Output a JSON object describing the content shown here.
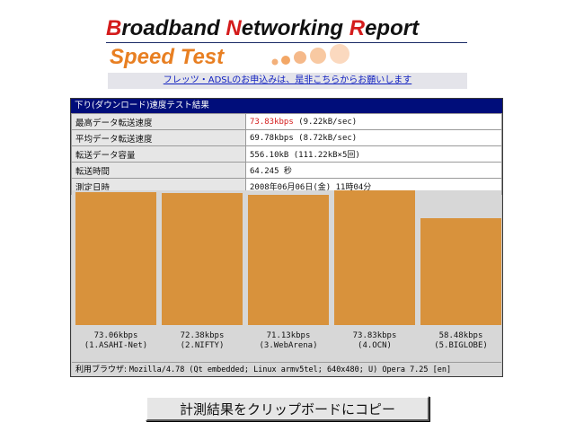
{
  "header": {
    "title_parts": [
      {
        "cap": "B",
        "rest": "roadband "
      },
      {
        "cap": "N",
        "rest": "etworking "
      },
      {
        "cap": "R",
        "rest": "eport"
      }
    ],
    "subtitle": "Speed Test"
  },
  "linkbar": {
    "text": "フレッツ・ADSLのお申込みは、是非こちらからお願いします"
  },
  "result": {
    "heading": "下り(ダウンロード)速度テスト結果",
    "rows": [
      {
        "label": "最高データ転送速度",
        "value_highlight": "73.83kbps",
        "value": " (9.22kB/sec)"
      },
      {
        "label": "平均データ転送速度",
        "value_highlight": "",
        "value": "69.78kbps (8.72kB/sec)"
      },
      {
        "label": "転送データ容量",
        "value_highlight": "",
        "value": "556.10kB (111.22kB×5回)"
      },
      {
        "label": "転送時間",
        "value_highlight": "",
        "value": "64.245 秒"
      },
      {
        "label": "測定日時",
        "value_highlight": "",
        "value": "2008年06月06日(金) 11時04分"
      }
    ],
    "browser_label": "利用ブラウザ: ",
    "browser_value": "Mozilla/4.78 (Qt embedded; Linux armv5tel; 640x480; U) Opera 7.25 [en]"
  },
  "chart_data": {
    "type": "bar",
    "categories": [
      "(1.ASAHI-Net)",
      "(2.NIFTY)",
      "(3.WebArena)",
      "(4.OCN)",
      "(5.BIGLOBE)"
    ],
    "values": [
      73.06,
      72.38,
      71.13,
      73.83,
      58.48
    ],
    "value_labels": [
      "73.06kbps",
      "72.38kbps",
      "71.13kbps",
      "73.83kbps",
      "58.48kbps"
    ],
    "ylim": [
      0,
      73.83
    ],
    "colors": {
      "bar": "#d8923c",
      "background": "#d7d7d7"
    }
  },
  "copy_button": {
    "label": "計測結果をクリップボードにコピー"
  },
  "colors": {
    "accent_red": "#d41c1c",
    "accent_orange": "#e87f22",
    "panel_header": "#000d7a"
  }
}
